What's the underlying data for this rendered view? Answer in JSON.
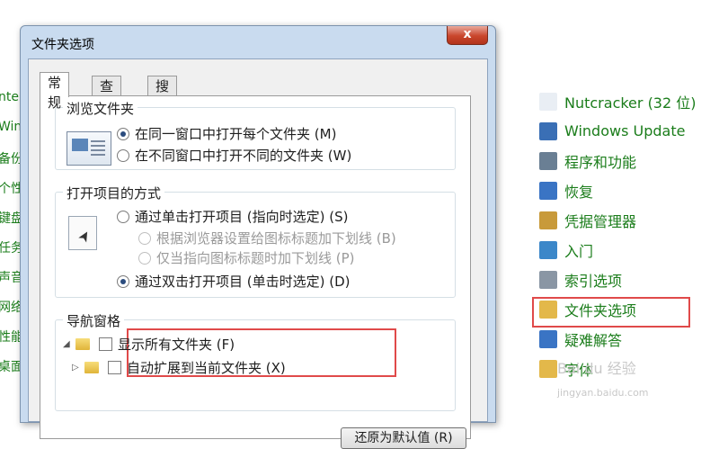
{
  "background": {
    "left_fragments": [
      "nte",
      "Win",
      "备份",
      "个性",
      "键盘",
      "任务",
      "声音",
      "网络",
      "性能",
      "桌面"
    ],
    "control_panel_items": [
      {
        "label": "Nutcracker (32 位)",
        "icon": "document-icon",
        "color": "#e9eef4"
      },
      {
        "label": "Windows Update",
        "icon": "windows-update-icon",
        "color": "#3a6fb5"
      },
      {
        "label": "程序和功能",
        "icon": "programs-icon",
        "color": "#6a7f94"
      },
      {
        "label": "恢复",
        "icon": "recovery-icon",
        "color": "#3a74c4"
      },
      {
        "label": "凭据管理器",
        "icon": "credential-icon",
        "color": "#c89a3a"
      },
      {
        "label": "入门",
        "icon": "getting-started-icon",
        "color": "#3b87c9"
      },
      {
        "label": "索引选项",
        "icon": "indexing-icon",
        "color": "#8a96a4"
      },
      {
        "label": "文件夹选项",
        "icon": "folder-options-icon",
        "color": "#e3b84a"
      },
      {
        "label": "疑难解答",
        "icon": "troubleshoot-icon",
        "color": "#3a74c4"
      },
      {
        "label": "字体",
        "icon": "font-icon",
        "color": "#e3b84a"
      }
    ],
    "watermark": "Bai du 经验",
    "watermark_url": "jingyan.baidu.com"
  },
  "dialog": {
    "title": "文件夹选项",
    "close_label": "x",
    "tabs": [
      "常规",
      "查看",
      "搜索"
    ],
    "active_tab": 0,
    "browse_group": {
      "title": "浏览文件夹",
      "options": [
        {
          "label": "在同一窗口中打开每个文件夹 (M)",
          "checked": true
        },
        {
          "label": "在不同窗口中打开不同的文件夹 (W)",
          "checked": false
        }
      ]
    },
    "click_group": {
      "title": "打开项目的方式",
      "single_click": {
        "label": "通过单击打开项目 (指向时选定) (S)",
        "checked": false
      },
      "underline_options": [
        {
          "label": "根据浏览器设置给图标标题加下划线 (B)",
          "checked": false
        },
        {
          "label": "仅当指向图标标题时加下划线 (P)",
          "checked": false
        }
      ],
      "double_click": {
        "label": "通过双击打开项目 (单击时选定) (D)",
        "checked": true
      }
    },
    "nav_group": {
      "title": "导航窗格",
      "show_all_folders": {
        "label": "显示所有文件夹 (F)",
        "checked": false
      },
      "auto_expand": {
        "label": "自动扩展到当前文件夹 (X)",
        "checked": false
      }
    },
    "restore_button": "还原为默认值 (R)"
  }
}
